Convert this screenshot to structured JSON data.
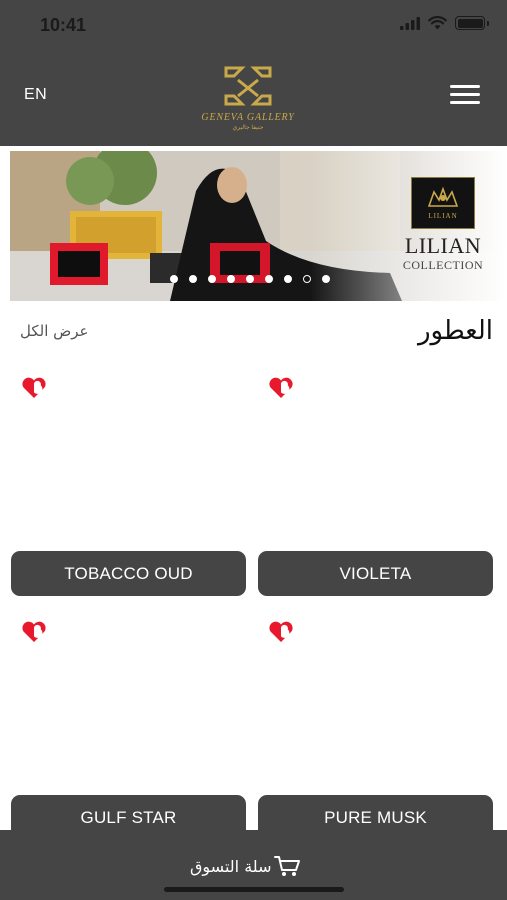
{
  "status_bar": {
    "time": "10:41"
  },
  "header": {
    "language": "EN",
    "logo_text": "GENEVA GALLERY",
    "logo_subtext": "جنيفا جاليري"
  },
  "banner": {
    "brand_box_text": "LILIAN",
    "brand_name": "LILIAN",
    "brand_collection": "COLLECTION",
    "slide_count": 9,
    "active_slide": 8
  },
  "section": {
    "title": "العطور",
    "view_all": "عرض الكل"
  },
  "products": [
    {
      "name": "TOBACCO OUD"
    },
    {
      "name": "VIOLETA"
    },
    {
      "name": "GULF STAR"
    },
    {
      "name": "PURE MUSK"
    }
  ],
  "bottom_bar": {
    "cart_label": "سلة التسوق"
  },
  "colors": {
    "header_bg": "#454545",
    "heart_red": "#e8192c",
    "gold": "#c9a94a"
  }
}
